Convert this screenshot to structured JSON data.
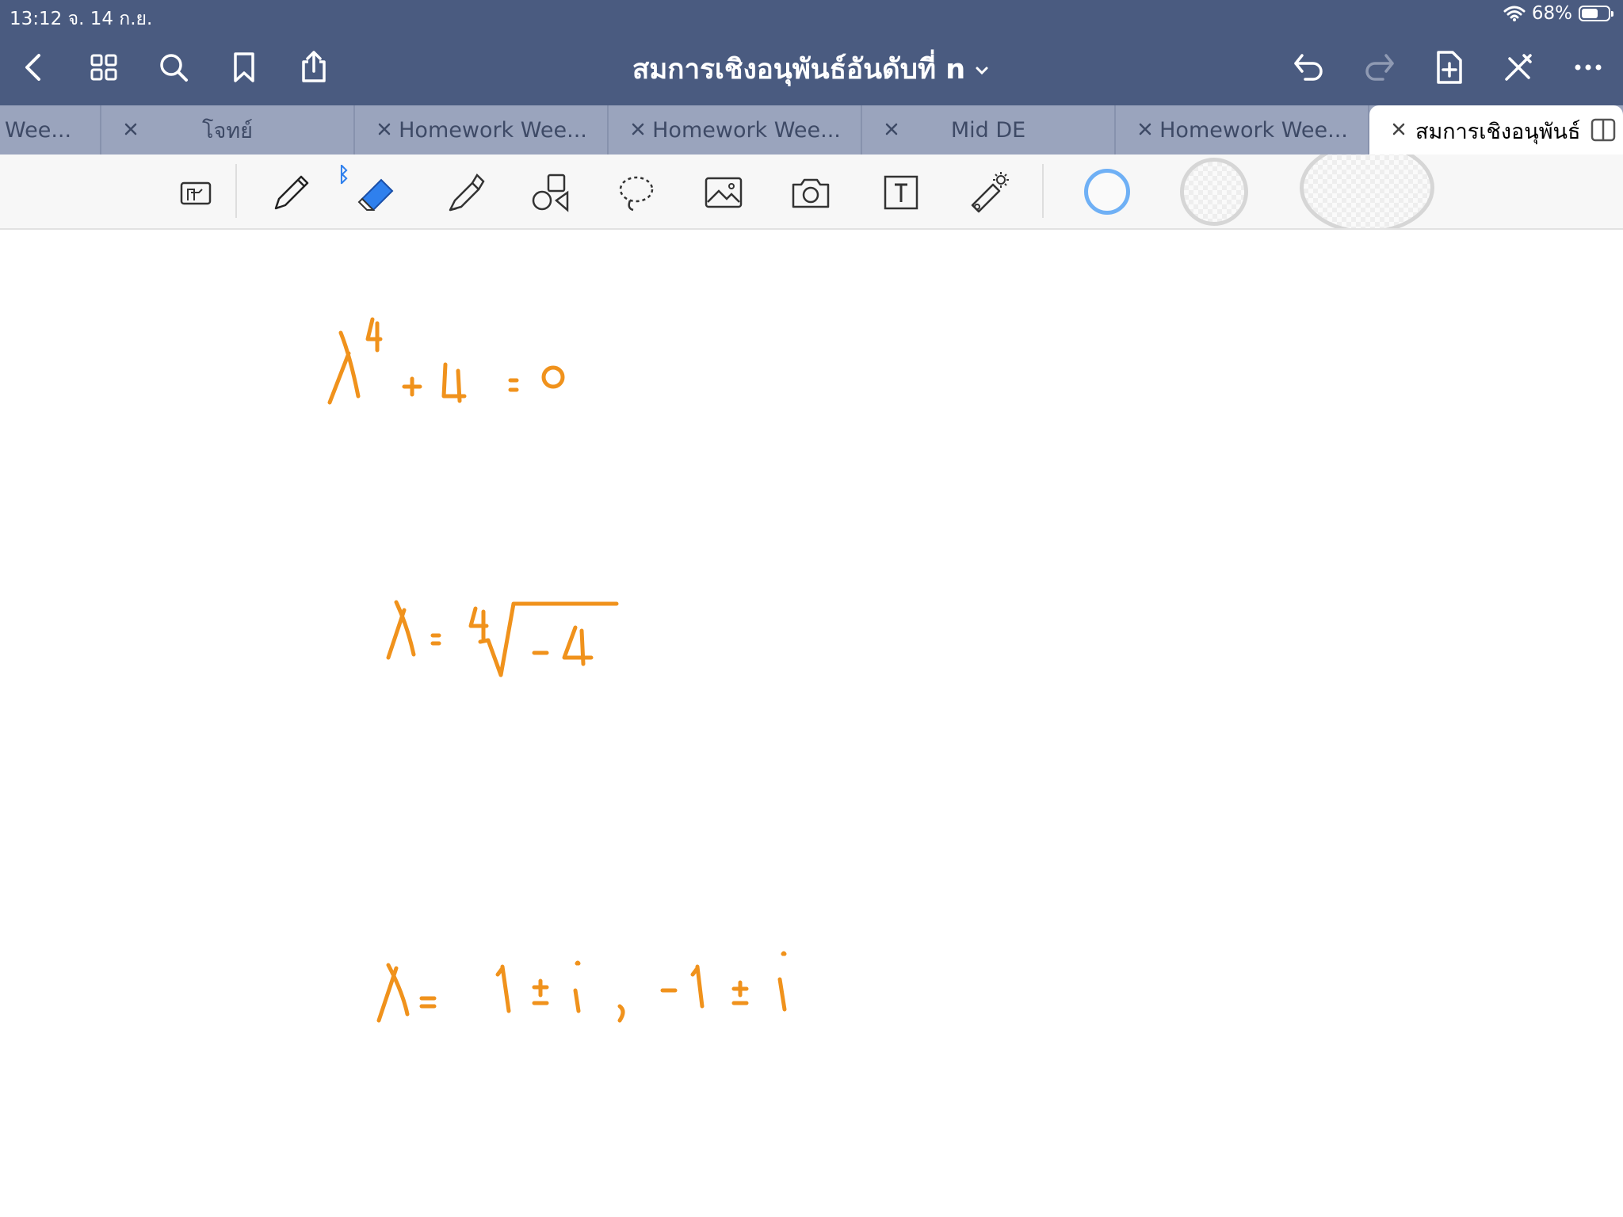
{
  "status_bar": {
    "time": "13:12  จ. 14 ก.ย.",
    "battery": "68%",
    "battery_level": 0.68
  },
  "nav": {
    "title": "สมการเชิงอนุพันธ์อันดับที่ n",
    "left_icons": [
      "back-chevron-icon",
      "grid-icon",
      "search-icon",
      "bookmark-icon",
      "share-icon"
    ],
    "right_icons": [
      "undo-icon",
      "redo-icon",
      "add-page-icon",
      "close-pen-icon",
      "more-icon"
    ]
  },
  "tabs": [
    {
      "label": "Wee..."
    },
    {
      "label": "โจทย์"
    },
    {
      "label": "Homework Wee..."
    },
    {
      "label": "Homework Wee..."
    },
    {
      "label": "Mid DE"
    },
    {
      "label": "Homework Wee..."
    },
    {
      "label": "สมการเชิงอนุพันธ์...",
      "active": true
    }
  ],
  "toolbar": {
    "tools": [
      "read-only-mode-icon",
      "pen-icon",
      "eraser-icon",
      "highlighter-icon",
      "shapes-icon",
      "lasso-icon",
      "image-icon",
      "camera-icon",
      "text-box-icon",
      "laser-pointer-icon"
    ],
    "active_tool": "eraser-icon",
    "bluetooth": "ᛒ",
    "sizes": [
      "small",
      "medium",
      "large"
    ],
    "selected_size": "small",
    "accent": "#2f80ed"
  },
  "handwriting": {
    "ink_color": "#f0921c"
  }
}
